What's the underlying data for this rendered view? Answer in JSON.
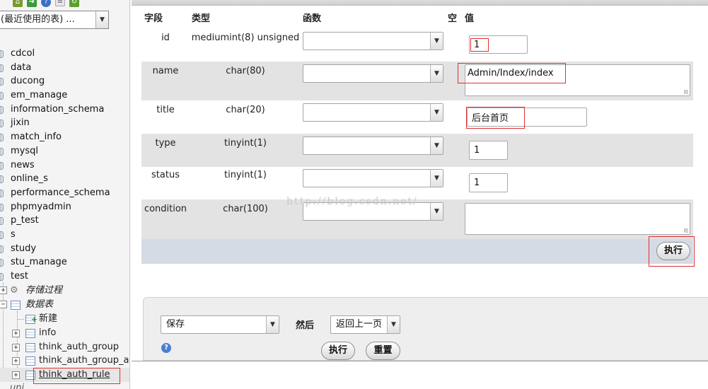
{
  "sidebar": {
    "toolbar_icons": [
      "home-icon",
      "exit-icon",
      "help-icon",
      "docs-icon",
      "reload-icon"
    ],
    "db_select_value": "(最近使用的表) ...",
    "databases": [
      "cdcol",
      "data",
      "ducong",
      "em_manage",
      "information_schema",
      "jixin",
      "match_info",
      "mysql",
      "news",
      "online_s",
      "performance_schema",
      "phpmyadmin",
      "p_test",
      "s",
      "study",
      "stu_manage",
      "test"
    ],
    "tree": {
      "procedures": "存储过程",
      "tables": "数据表",
      "new": "新建",
      "items": [
        "info",
        "think_auth_group",
        "think_auth_group_ac",
        "think_auth_rule"
      ],
      "next_db": "uni"
    }
  },
  "form": {
    "headers": {
      "field": "字段",
      "type": "类型",
      "function": "函数",
      "null": "空",
      "value": "值"
    },
    "rows": [
      {
        "name": "id",
        "type": "mediumint(8) unsigned",
        "value": "1"
      },
      {
        "name": "name",
        "type": "char(80)",
        "value": "Admin/Index/index"
      },
      {
        "name": "title",
        "type": "char(20)",
        "value": "后台首页"
      },
      {
        "name": "type",
        "type": "tinyint(1)",
        "value": "1"
      },
      {
        "name": "status",
        "type": "tinyint(1)",
        "value": "1"
      },
      {
        "name": "condition",
        "type": "char(100)",
        "value": ""
      }
    ],
    "execute_label": "执行"
  },
  "watermark": "http://blog.csdn.net/",
  "bottom": {
    "save_select": "保存",
    "then_label": "然后",
    "after_select": "返回上一页",
    "execute_label": "执行",
    "reset_label": "重置"
  }
}
